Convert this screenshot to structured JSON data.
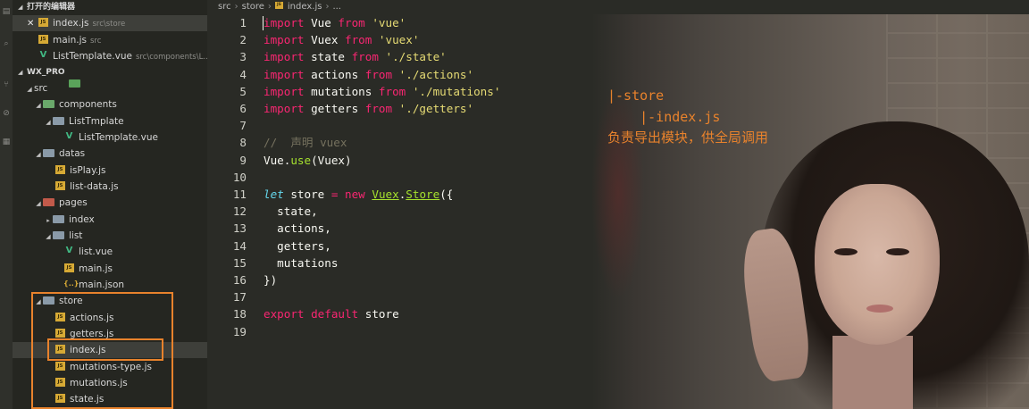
{
  "sidebar": {
    "open_editors": {
      "title": "打开的编辑器",
      "items": [
        {
          "name": "index.js",
          "desc": "src\\store"
        },
        {
          "name": "main.js",
          "desc": "src"
        },
        {
          "name": "ListTemplate.vue",
          "desc": "src\\components\\L..."
        }
      ]
    },
    "project": {
      "title": "WX_PRO",
      "tree": {
        "src": "src",
        "components": "components",
        "list_tmplate": "ListTmplate",
        "list_template_vue": "ListTemplate.vue",
        "datas": "datas",
        "isplay": "isPlay.js",
        "list_data": "list-data.js",
        "pages": "pages",
        "index_folder": "index",
        "list_folder": "list",
        "list_vue": "list.vue",
        "main_js": "main.js",
        "main_json": "main.json",
        "store": "store",
        "actions": "actions.js",
        "getters": "getters.js",
        "index_js": "index.js",
        "mutations_type": "mutations-type.js",
        "mutations": "mutations.js",
        "state": "state.js"
      }
    }
  },
  "breadcrumb": [
    "src",
    "store",
    "index.js",
    "..."
  ],
  "code": {
    "line_numbers": [
      "1",
      "2",
      "3",
      "4",
      "5",
      "6",
      "7",
      "8",
      "9",
      "10",
      "11",
      "12",
      "13",
      "14",
      "15",
      "16",
      "17",
      "18",
      "19"
    ],
    "l1": [
      "import",
      " Vue ",
      "from",
      " 'vue'"
    ],
    "l2": [
      "import",
      " Vuex ",
      "from",
      " 'vuex'"
    ],
    "l3": [
      "import",
      " state ",
      "from",
      " './state'"
    ],
    "l4": [
      "import",
      " actions ",
      "from",
      " './actions'"
    ],
    "l5": [
      "import",
      " mutations ",
      "from",
      " './mutations'"
    ],
    "l6": [
      "import",
      " getters ",
      "from",
      " './getters'"
    ],
    "l8": "//  声明 vuex",
    "l9": [
      "Vue.",
      "use",
      "(Vuex)"
    ],
    "l11": [
      "let",
      " store ",
      "=",
      " ",
      "new",
      " ",
      "Vuex",
      ".",
      "Store",
      "({"
    ],
    "l12": "  state,",
    "l13": "  actions,",
    "l14": "  getters,",
    "l15": "  mutations",
    "l16": "})",
    "l18": [
      "export",
      " ",
      "default",
      " store"
    ]
  },
  "annotation": {
    "line1": "|-store",
    "line2": "    |-index.js",
    "line3": "负责导出模块，供全局调用"
  },
  "colors": {
    "highlight_box": "#e8822c",
    "annotation_text": "#e8822c"
  }
}
